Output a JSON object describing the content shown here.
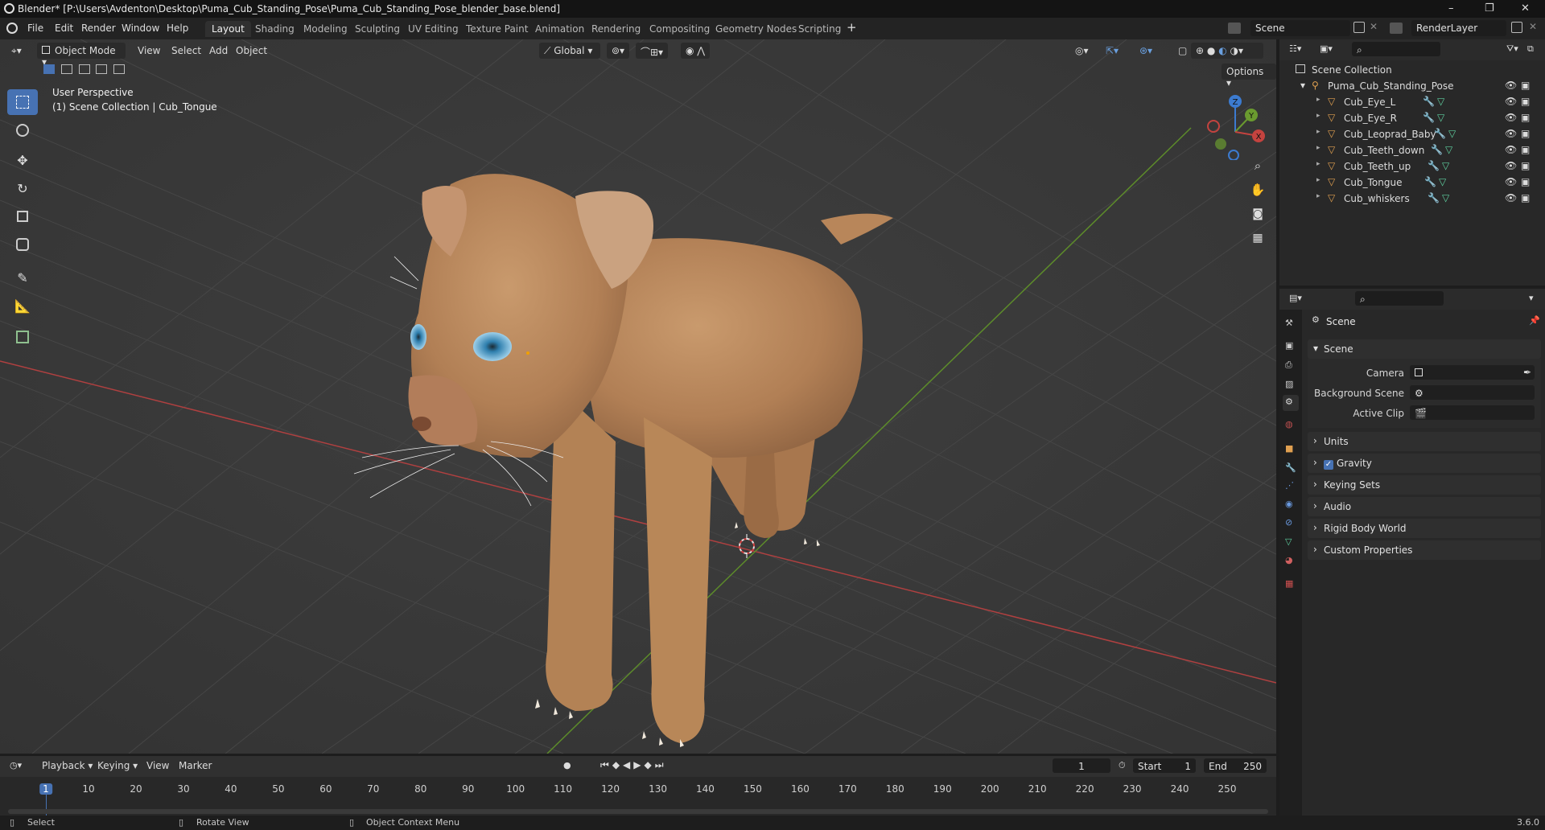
{
  "window": {
    "title": "Blender* [P:\\Users\\Avdenton\\Desktop\\Puma_Cub_Standing_Pose\\Puma_Cub_Standing_Pose_blender_base.blend]",
    "minimize": "–",
    "maximize": "❐",
    "close": "✕"
  },
  "menubar": {
    "items": [
      "File",
      "Edit",
      "Render",
      "Window",
      "Help"
    ],
    "workspaces": [
      "Layout",
      "Shading",
      "Modeling",
      "Sculpting",
      "UV Editing",
      "Texture Paint",
      "Animation",
      "Rendering",
      "Compositing",
      "Geometry Nodes",
      "Scripting"
    ],
    "active_workspace": "Layout",
    "add_workspace": "+",
    "scene": "Scene",
    "view_layer": "RenderLayer"
  },
  "viewport_header": {
    "mode": "Object Mode",
    "menus": [
      "View",
      "Select",
      "Add",
      "Object"
    ],
    "orientation": "Global",
    "options": "Options"
  },
  "viewport": {
    "perspective": "User Perspective",
    "context": "(1) Scene Collection | Cub_Tongue",
    "gizmo": {
      "z": "Z",
      "y": "Y",
      "x": "X"
    },
    "colors": {
      "x_axis": "#c4433f",
      "y_axis": "#6a9a2f",
      "z_axis": "#3c7bd0",
      "active_tool": "#4772b3"
    }
  },
  "outliner": {
    "root": "Scene Collection",
    "collection": "Puma_Cub_Standing_Pose",
    "objects": [
      "Cub_Eye_L",
      "Cub_Eye_R",
      "Cub_Leoprad_Baby",
      "Cub_Teeth_down",
      "Cub_Teeth_up",
      "Cub_Tongue",
      "Cub_whiskers"
    ]
  },
  "properties": {
    "context": "Scene",
    "section": "Scene",
    "fields": [
      {
        "label": "Camera",
        "value": ""
      },
      {
        "label": "Background Scene",
        "value": ""
      },
      {
        "label": "Active Clip",
        "value": ""
      }
    ],
    "panels": [
      "Units",
      "Gravity",
      "Keying Sets",
      "Audio",
      "Rigid Body World",
      "Custom Properties"
    ],
    "gravity_checked": true
  },
  "timeline": {
    "menus": [
      "Playback",
      "Keying",
      "View",
      "Marker"
    ],
    "current_frame": "1",
    "start_label": "Start",
    "start": "1",
    "end_label": "End",
    "end": "250",
    "ticks": [
      "1",
      "10",
      "20",
      "30",
      "40",
      "50",
      "60",
      "70",
      "80",
      "90",
      "100",
      "110",
      "120",
      "130",
      "140",
      "150",
      "160",
      "170",
      "180",
      "190",
      "200",
      "210",
      "220",
      "230",
      "240",
      "250"
    ]
  },
  "statusbar": {
    "select": "Select",
    "rotate": "Rotate View",
    "context_menu": "Object Context Menu",
    "version": "3.6.0"
  }
}
